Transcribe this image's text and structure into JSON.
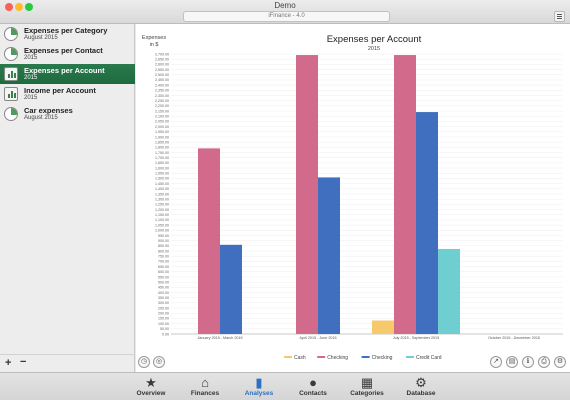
{
  "window": {
    "title": "Demo",
    "app_name": "iFinance - 4.0"
  },
  "sidebar": {
    "items": [
      {
        "title": "Expenses per Category",
        "subtitle": "August 2015",
        "icon": "pie-chart-icon",
        "active": false
      },
      {
        "title": "Expenses per Contact",
        "subtitle": "2015",
        "icon": "pie-chart-icon",
        "active": false
      },
      {
        "title": "Expenses per Account",
        "subtitle": "2015",
        "icon": "bar-chart-icon",
        "active": true
      },
      {
        "title": "Income per Account",
        "subtitle": "2015",
        "icon": "bar-chart-icon",
        "active": false
      },
      {
        "title": "Car expenses",
        "subtitle": "August 2015",
        "icon": "pie-chart-icon",
        "active": false
      }
    ],
    "add_label": "+",
    "remove_label": "−"
  },
  "chart_data": {
    "type": "bar",
    "title": "Expenses per Account",
    "subtitle": "2015",
    "ylabel": "Expenses in $",
    "ylim": [
      0,
      2700
    ],
    "ytick_step": 50,
    "categories": [
      "January 2015 - March 2015",
      "April 2015 - June 2015",
      "July 2015 - September 2015",
      "October 2015 - December 2015"
    ],
    "series": [
      {
        "name": "Cash",
        "color": "#f6c96b",
        "values": [
          0,
          0,
          130,
          0
        ]
      },
      {
        "name": "Checking",
        "color": "#d26a8c",
        "values": [
          1790,
          2690,
          2690,
          0
        ]
      },
      {
        "name": "Checking",
        "color": "#3f6fbe",
        "values": [
          860,
          1510,
          2140,
          0
        ]
      },
      {
        "name": "Credit Card",
        "color": "#6fcfd0",
        "values": [
          0,
          0,
          820,
          0
        ]
      }
    ],
    "legend_position": "bottom",
    "grid": true
  },
  "tabs": [
    {
      "label": "Overview",
      "icon": "star-icon",
      "glyph": "★",
      "active": false
    },
    {
      "label": "Finances",
      "icon": "bank-icon",
      "glyph": "⌂",
      "active": false
    },
    {
      "label": "Analyses",
      "icon": "bar-chart-icon",
      "glyph": "▮",
      "active": true
    },
    {
      "label": "Contacts",
      "icon": "person-icon",
      "glyph": "●",
      "active": false
    },
    {
      "label": "Categories",
      "icon": "categories-icon",
      "glyph": "▦",
      "active": false
    },
    {
      "label": "Database",
      "icon": "gear-icon",
      "glyph": "⚙",
      "active": false
    }
  ]
}
